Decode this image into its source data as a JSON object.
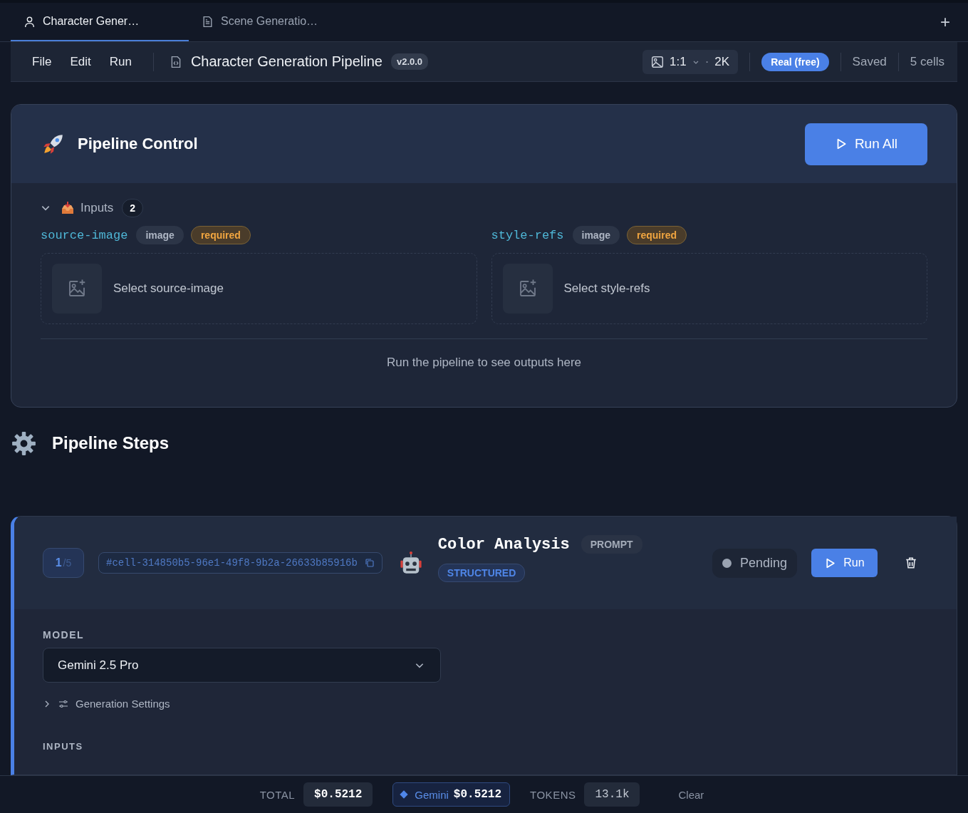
{
  "tabs": [
    {
      "label": "Character Gener…",
      "kind": "person",
      "selected": true
    },
    {
      "label": "Scene Generatio…",
      "kind": "document",
      "selected": false
    }
  ],
  "new_tab": "+",
  "menu": [
    "File",
    "Edit",
    "Run"
  ],
  "document": {
    "title": "Character Generation Pipeline",
    "version": "v2.0.0"
  },
  "toolbar": {
    "aspect": "1:1",
    "separator": "·",
    "resolution": "2K",
    "mode": "Real (free)",
    "save_status": "Saved",
    "cell_count": "5 cells"
  },
  "pipeline_control": {
    "title": "Pipeline Control",
    "run_all": "Run All",
    "inputs": {
      "label": "Inputs",
      "count": "2",
      "expanded": true,
      "items": [
        {
          "name": "source-image",
          "type": "image",
          "badge": "required",
          "placeholder": "Select source-image"
        },
        {
          "name": "style-refs",
          "type": "image",
          "badge": "required",
          "placeholder": "Select style-refs"
        }
      ]
    },
    "outputs_hint": "Run the pipeline to see outputs here"
  },
  "steps_title": "Pipeline Steps",
  "cell": {
    "index": "1",
    "total": "/5",
    "id": "#cell-314850b5-96e1-49f8-9b2a-26633b85916b",
    "title": "Color Analysis",
    "type": "PROMPT",
    "tag": "STRUCTURED",
    "status": "Pending",
    "run": "Run",
    "model_label": "MODEL",
    "model": "Gemini 2.5 Pro",
    "settings": "Generation Settings",
    "settings_expanded": false,
    "inputs_label": "INPUTS"
  },
  "footer": {
    "total_label": "TOTAL",
    "total": "$0.5212",
    "provider": "Gemini",
    "provider_cost": "$0.5212",
    "tokens_label": "TOKENS",
    "tokens": "13.1k",
    "clear": "Clear"
  }
}
